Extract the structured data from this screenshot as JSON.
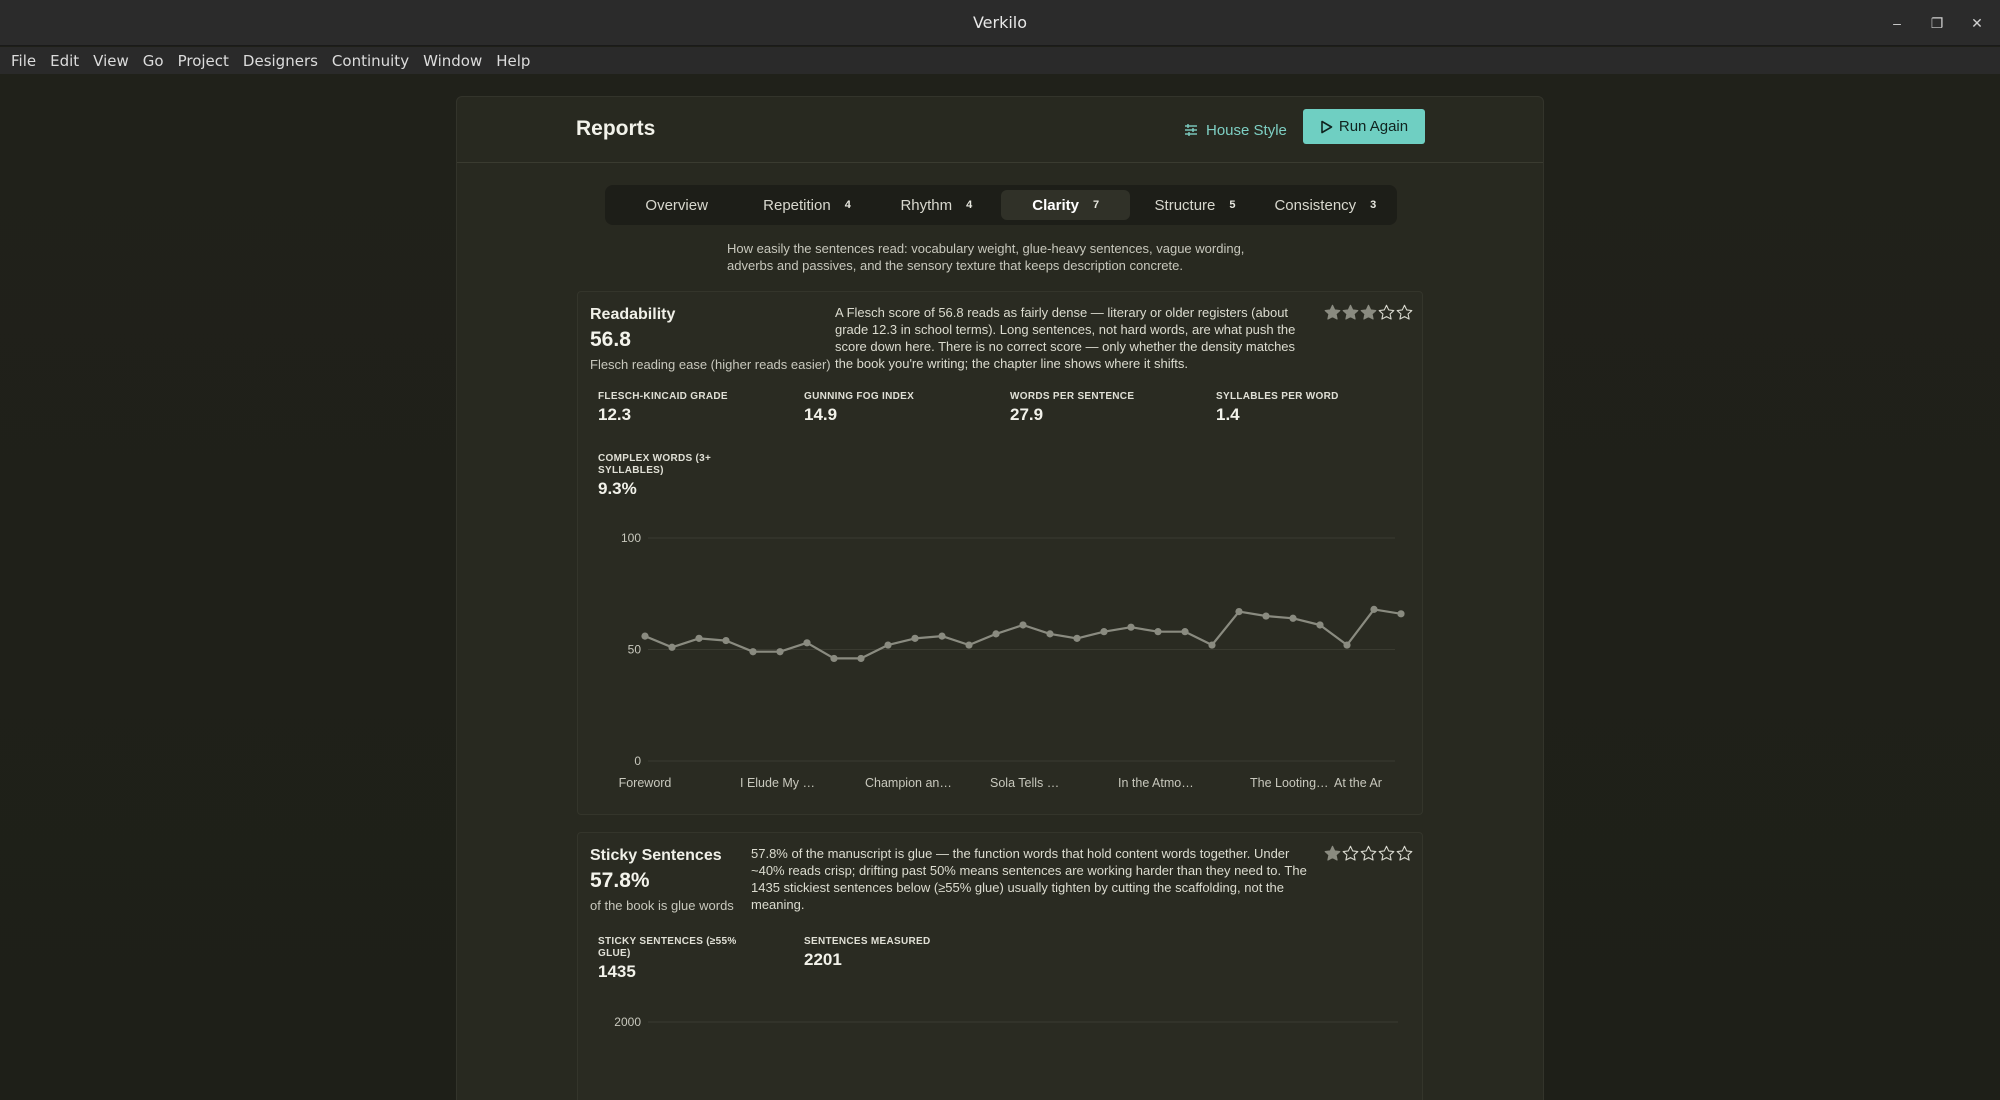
{
  "window": {
    "title": "Verkilo",
    "controls": {
      "minimize": "–",
      "maximize": "❐",
      "close": "✕"
    }
  },
  "menu": [
    "File",
    "Edit",
    "View",
    "Go",
    "Project",
    "Designers",
    "Continuity",
    "Window",
    "Help"
  ],
  "header": {
    "title": "Reports",
    "house_style": "House Style",
    "run_again": "Run Again"
  },
  "tabs": [
    {
      "label": "Overview",
      "count": ""
    },
    {
      "label": "Repetition",
      "count": "4"
    },
    {
      "label": "Rhythm",
      "count": "4"
    },
    {
      "label": "Clarity",
      "count": "7",
      "active": true
    },
    {
      "label": "Structure",
      "count": "5"
    },
    {
      "label": "Consistency",
      "count": "3"
    }
  ],
  "description": "How easily the sentences read: vocabulary weight, glue-heavy sentences, vague wording, adverbs and passives, and the sensory texture that keeps description concrete.",
  "readability": {
    "title": "Readability",
    "value": "56.8",
    "subtitle": "Flesch reading ease (higher reads easier)",
    "body": "A Flesch score of 56.8 reads as fairly dense — literary or older registers (about grade 12.3 in school terms). Long sentences, not hard words, are what push the score down here. There is no correct score — only whether the density matches the book you're writing; the chapter line shows where it shifts.",
    "rating": 3,
    "metrics": [
      {
        "label": "FLESCH-KINCAID GRADE",
        "value": "12.3"
      },
      {
        "label": "GUNNING FOG INDEX",
        "value": "14.9"
      },
      {
        "label": "WORDS PER SENTENCE",
        "value": "27.9"
      },
      {
        "label": "SYLLABLES PER WORD",
        "value": "1.4"
      },
      {
        "label": "COMPLEX WORDS (3+ SYLLABLES)",
        "value": "9.3%"
      }
    ]
  },
  "sticky": {
    "title": "Sticky Sentences",
    "value": "57.8%",
    "subtitle": "of the book is glue words",
    "body": "57.8% of the manuscript is glue — the function words that hold content words together. Under ~40% reads crisp; drifting past 50% means sentences are working harder than they need to. The 1435 stickiest sentences below (≥55% glue) usually tighten by cutting the scaffolding, not the meaning.",
    "rating": 1,
    "metrics": [
      {
        "label": "STICKY SENTENCES (≥55% GLUE)",
        "value": "1435"
      },
      {
        "label": "SENTENCES MEASURED",
        "value": "2201"
      }
    ],
    "chart_tick": "2000"
  },
  "chart_data": {
    "type": "line",
    "ylim": [
      0,
      100
    ],
    "yticks": [
      "0",
      "50",
      "100"
    ],
    "xlabels": [
      "Foreword",
      "I Elude My …",
      "Champion an…",
      "Sola Tells …",
      "In the Atmo…",
      "The Looting…",
      "At the Ar"
    ],
    "series": [
      {
        "values": [
          56,
          51,
          55,
          54,
          49,
          49,
          53,
          46,
          46,
          52,
          55,
          56,
          52,
          57,
          61,
          57,
          55,
          58,
          60,
          58,
          58,
          52,
          67,
          65,
          64,
          61,
          52,
          68,
          66
        ]
      }
    ],
    "grid": true,
    "color": "#8a8b80"
  }
}
